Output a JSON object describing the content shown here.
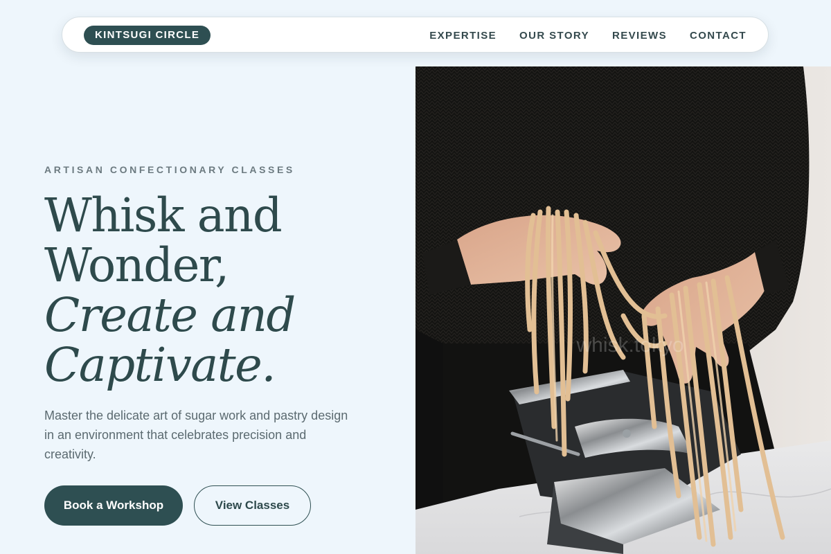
{
  "nav": {
    "brand": "KINTSUGI CIRCLE",
    "links": [
      "EXPERTISE",
      "OUR STORY",
      "REVIEWS",
      "CONTACT"
    ]
  },
  "hero": {
    "eyebrow": "ARTISAN CONFECTIONARY CLASSES",
    "headline": {
      "line1": "Whisk and",
      "line2": "Wonder,",
      "line3": "Create and",
      "line4": "Captivate."
    },
    "description": "Master the delicate art of sugar work and pastry design in an environment that celebrates precision and creativity.",
    "primary_button": "Book a Workshop",
    "secondary_button": "View Classes",
    "image_watermark": "whisk.tokyo"
  },
  "colors": {
    "background": "#eef6fc",
    "accent": "#2e4f52",
    "heading": "#2e4a4c",
    "body_text": "#5b6a70"
  }
}
